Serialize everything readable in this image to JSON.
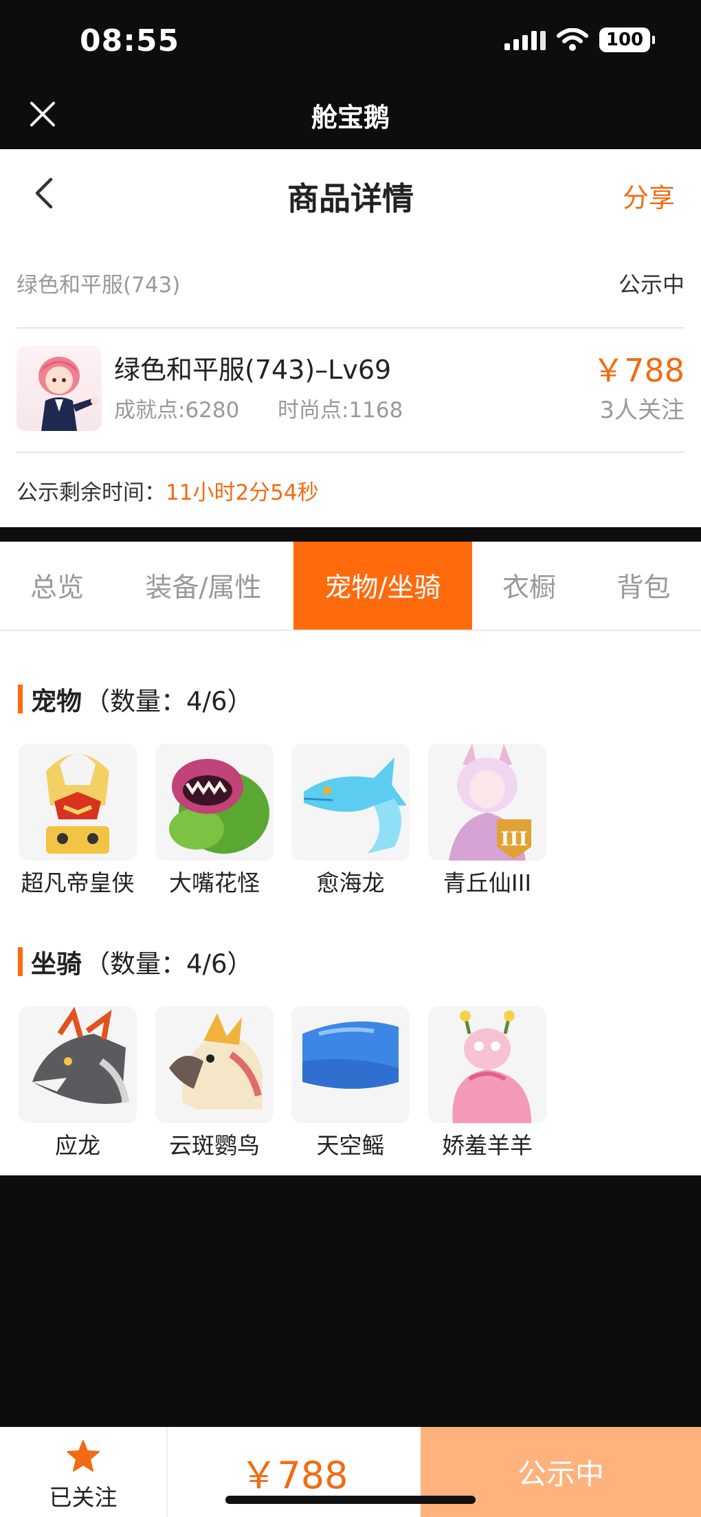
{
  "status_bar": {
    "time": "08:55",
    "battery": "100"
  },
  "app": {
    "title": "舱宝鹅",
    "close_icon": "close-icon"
  },
  "nav": {
    "title": "商品详情",
    "share_label": "分享",
    "back_icon": "chevron-left-icon"
  },
  "listing": {
    "name": "绿色和平服(743)",
    "status": "公示中",
    "product_name": "绿色和平服(743)–Lv69",
    "achievement": "成就点:6280",
    "fashion": "时尚点:1168",
    "price": "￥788",
    "followers": "3人关注",
    "remaining_label": "公示剩余时间：",
    "remaining_value": "11小时2分54秒"
  },
  "tabs": [
    {
      "label": "总览",
      "active": false
    },
    {
      "label": "装备/属性",
      "active": false
    },
    {
      "label": "宠物/坐骑",
      "active": true
    },
    {
      "label": "衣橱",
      "active": false
    },
    {
      "label": "背包",
      "active": false
    }
  ],
  "pets": {
    "title": "宠物",
    "count": "（数量：4/6）",
    "items": [
      {
        "name": "超凡帝皇侠"
      },
      {
        "name": "大嘴花怪"
      },
      {
        "name": "愈海龙"
      },
      {
        "name": "青丘仙III"
      }
    ]
  },
  "mounts": {
    "title": "坐骑",
    "count": "（数量：4/6）",
    "items": [
      {
        "name": "应龙"
      },
      {
        "name": "云斑鹦鸟"
      },
      {
        "name": "天空鳐"
      },
      {
        "name": "娇羞羊羊"
      }
    ]
  },
  "footer": {
    "follow_label": "已关注",
    "price": "￥788",
    "status": "公示中"
  },
  "colors": {
    "accent": "#ff6a0d",
    "price": "#f26b12",
    "status_button": "#ffb27c"
  }
}
